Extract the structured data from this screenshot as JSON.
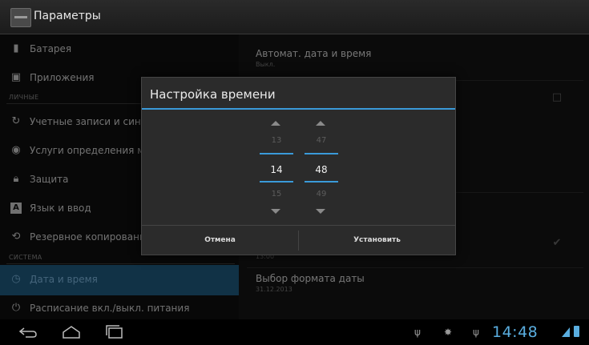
{
  "action_bar": {
    "title": "Параметры"
  },
  "left_pane": {
    "items_top": [
      {
        "label": "Батарея",
        "icon": "battery-icon"
      },
      {
        "label": "Приложения",
        "icon": "apps-icon"
      }
    ],
    "section_personal": "ЛИЧНЫЕ",
    "items_personal": [
      {
        "label": "Учетные записи и синх",
        "icon": "sync-icon"
      },
      {
        "label": "Услуги определения ме",
        "icon": "location-icon"
      },
      {
        "label": "Защита",
        "icon": "lock-icon"
      },
      {
        "label": "Язык и ввод",
        "icon": "keyboard-icon"
      },
      {
        "label": "Резервное копировани",
        "icon": "backup-icon"
      }
    ],
    "section_system": "СИСТЕМА",
    "items_system": [
      {
        "label": "Дата и время",
        "icon": "clock-icon",
        "selected": true
      },
      {
        "label": "Расписание вкл./выкл. питания",
        "icon": "power-icon"
      }
    ]
  },
  "right_pane": {
    "auto_datetime": {
      "title": "Автомат. дата и время",
      "summary": "Выкл."
    },
    "time_format_summary": "13:00",
    "date_format": {
      "title": "Выбор формата даты",
      "summary": "31.12.2013"
    }
  },
  "dialog": {
    "title": "Настройка времени",
    "hours": {
      "prev": "13",
      "current": "14",
      "next": "15"
    },
    "minutes": {
      "prev": "47",
      "current": "48",
      "next": "49"
    },
    "cancel_label": "Отмена",
    "set_label": "Установить"
  },
  "status_bar": {
    "time": "14:48"
  },
  "colors": {
    "accent": "#3a9ad9",
    "selected_bg": "#1f5b80",
    "clock": "#5aaee0"
  }
}
